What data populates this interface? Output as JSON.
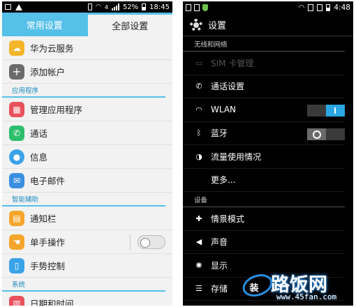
{
  "left": {
    "status": {
      "signal": "4",
      "battery": "52%",
      "time": "18:45"
    },
    "tabs": [
      {
        "label": "常用设置"
      },
      {
        "label": "全部设置"
      }
    ],
    "rows_top": [
      {
        "label": "华为云服务",
        "icon": "cloud-icon",
        "color": "#f4b52b"
      },
      {
        "label": "添加帐户",
        "icon": "plus-icon",
        "color": "#6b6b6b"
      }
    ],
    "section_apps": "应用程序",
    "rows_apps": [
      {
        "label": "管理应用程序",
        "icon": "apps-grid-icon",
        "color": "#e8505b"
      },
      {
        "label": "通话",
        "icon": "phone-icon",
        "color": "#2dbf6b"
      },
      {
        "label": "信息",
        "icon": "message-icon",
        "color": "#3aa3e8"
      },
      {
        "label": "电子邮件",
        "icon": "mail-icon",
        "color": "#3a8fe0"
      }
    ],
    "section_assist": "智能辅助",
    "rows_assist": [
      {
        "label": "通知栏",
        "icon": "notification-icon",
        "color": "#f4a52b"
      },
      {
        "label": "单手操作",
        "icon": "one-hand-icon",
        "color": "#f4a52b"
      },
      {
        "label": "手势控制",
        "icon": "gesture-icon",
        "color": "#3aa3e8"
      }
    ],
    "section_system": "系统",
    "rows_system": [
      {
        "label": "日期和时间",
        "icon": "calendar-icon",
        "color": "#e8505b"
      }
    ]
  },
  "right": {
    "status": {
      "time": "4:48"
    },
    "title": "设置",
    "section_wireless": "无线和网络",
    "rows_wireless": [
      {
        "label": "SIM 卡管理",
        "icon": "sim-icon",
        "disabled": true
      },
      {
        "label": "通话设置",
        "icon": "phone-icon"
      },
      {
        "label": "WLAN",
        "icon": "wifi-icon",
        "toggle": "on"
      },
      {
        "label": "蓝牙",
        "icon": "bluetooth-icon",
        "toggle": "off"
      },
      {
        "label": "流量使用情况",
        "icon": "data-usage-icon"
      },
      {
        "label": "更多...",
        "icon": ""
      }
    ],
    "section_device": "设备",
    "rows_device": [
      {
        "label": "情景模式",
        "icon": "profile-icon"
      },
      {
        "label": "声音",
        "icon": "sound-icon"
      },
      {
        "label": "显示",
        "icon": "display-icon"
      },
      {
        "label": "存储",
        "icon": "storage-icon"
      }
    ]
  },
  "watermark": {
    "brand": "路饭网",
    "url": "www.45fan.com",
    "logo": "装"
  }
}
